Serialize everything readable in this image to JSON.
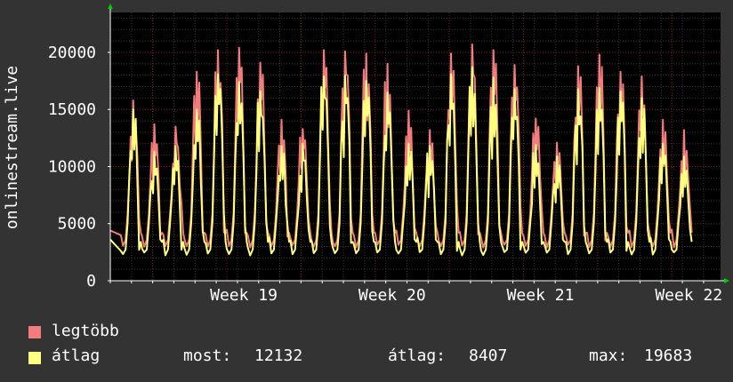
{
  "chart_data": {
    "type": "line",
    "title": "",
    "ylabel": "onlinestream.live",
    "xlabel": "",
    "ylim": [
      0,
      23500
    ],
    "y_ticks": [
      0,
      5000,
      10000,
      15000,
      20000
    ],
    "y_tick_labels": [
      "0",
      "5000",
      "10000",
      "15000",
      "20000"
    ],
    "x_range_days": [
      0,
      28.8
    ],
    "x_ticks": [
      {
        "label": "Week 19",
        "day": 6.3
      },
      {
        "label": "Week 20",
        "day": 13.3
      },
      {
        "label": "Week 21",
        "day": 20.3
      },
      {
        "label": "Week 22",
        "day": 27.3
      }
    ],
    "grid": true,
    "background": "#000000",
    "grid_color": "#8b1d1d",
    "series": [
      {
        "name": "legtöbb",
        "color": "#f47c7c",
        "daily_peak": [
          15800,
          13700,
          13500,
          18300,
          20200,
          20400,
          19100,
          14100,
          13300,
          20200,
          20100,
          19900,
          19000,
          14900,
          13200,
          19900,
          20700,
          20200,
          18900,
          14200,
          12100,
          18800,
          19800,
          18300,
          17900,
          14100,
          13200
        ],
        "daily_trough": 3400
      },
      {
        "name": "átlag",
        "color": "#ffff80",
        "daily_peak": [
          15000,
          11300,
          11800,
          15000,
          18100,
          17400,
          16600,
          11800,
          12000,
          17900,
          18000,
          17500,
          16500,
          12000,
          11800,
          18100,
          18700,
          17800,
          16800,
          11900,
          10900,
          16800,
          16900,
          16600,
          16000,
          12000,
          10900
        ],
        "daily_trough": 2600
      }
    ],
    "stats": {
      "most_label": "most:",
      "most_value": "12132",
      "atlag_label": "átlag:",
      "atlag_value": "8407",
      "max_label": "max:",
      "max_value": "19683"
    }
  }
}
